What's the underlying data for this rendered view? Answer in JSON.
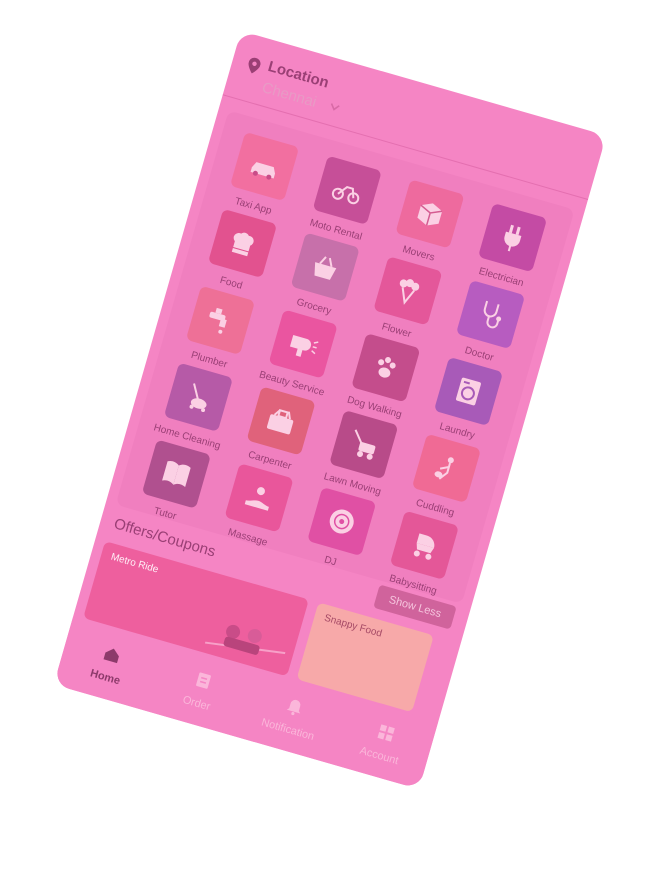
{
  "location": {
    "title": "Location",
    "city": "Chennai"
  },
  "services": [
    {
      "label": "Taxi App",
      "icon": "car-icon",
      "color": "#f26fa0"
    },
    {
      "label": "Moto Rental",
      "icon": "motorbike-icon",
      "color": "#c64f98"
    },
    {
      "label": "Movers",
      "icon": "box-icon",
      "color": "#ee6a9e"
    },
    {
      "label": "Electrician",
      "icon": "plug-icon",
      "color": "#c44ba4"
    },
    {
      "label": "Food",
      "icon": "chef-hat-icon",
      "color": "#e2528f"
    },
    {
      "label": "Grocery",
      "icon": "grocery-basket-icon",
      "color": "#c770aa"
    },
    {
      "label": "Flower",
      "icon": "flower-icon",
      "color": "#e4579a"
    },
    {
      "label": "Doctor",
      "icon": "stethoscope-icon",
      "color": "#b75cc0"
    },
    {
      "label": "Plumber",
      "icon": "faucet-icon",
      "color": "#ee7097"
    },
    {
      "label": "Beauty Service",
      "icon": "hair-dryer-icon",
      "color": "#ea55a0"
    },
    {
      "label": "Dog Walking",
      "icon": "paw-icon",
      "color": "#c44d8c"
    },
    {
      "label": "Laundry",
      "icon": "washing-machine-icon",
      "color": "#a85ab8"
    },
    {
      "label": "Home Cleaning",
      "icon": "vacuum-icon",
      "color": "#b65aa7"
    },
    {
      "label": "Carpenter",
      "icon": "toolbox-icon",
      "color": "#e0627b"
    },
    {
      "label": "Lawn Moving",
      "icon": "lawn-mower-icon",
      "color": "#b84b89"
    },
    {
      "label": "Cuddling",
      "icon": "cuddling-icon",
      "color": "#f06a95"
    },
    {
      "label": "Tutor",
      "icon": "book-icon",
      "color": "#b0508f"
    },
    {
      "label": "Massage",
      "icon": "massage-hand-icon",
      "color": "#e9569b"
    },
    {
      "label": "DJ",
      "icon": "vinyl-record-icon",
      "color": "#e050a4"
    },
    {
      "label": "Babysitting",
      "icon": "stroller-icon",
      "color": "#e45798"
    }
  ],
  "offers": {
    "title": "Offers/Coupons",
    "show_less": "Show Less",
    "coupons": [
      {
        "title": "Metro Ride"
      },
      {
        "title": "Snappy Food"
      }
    ]
  },
  "nav": {
    "items": [
      {
        "label": "Home",
        "icon": "home-icon",
        "active": true
      },
      {
        "label": "Order",
        "icon": "order-icon",
        "active": false
      },
      {
        "label": "Notification",
        "icon": "bell-icon",
        "active": false
      },
      {
        "label": "Account",
        "icon": "grid-account-icon",
        "active": false
      }
    ]
  },
  "colors": {
    "overlay_pink": "#f585c4",
    "text_dark": "#9a3f75",
    "text_faded": "#fbb6da"
  }
}
